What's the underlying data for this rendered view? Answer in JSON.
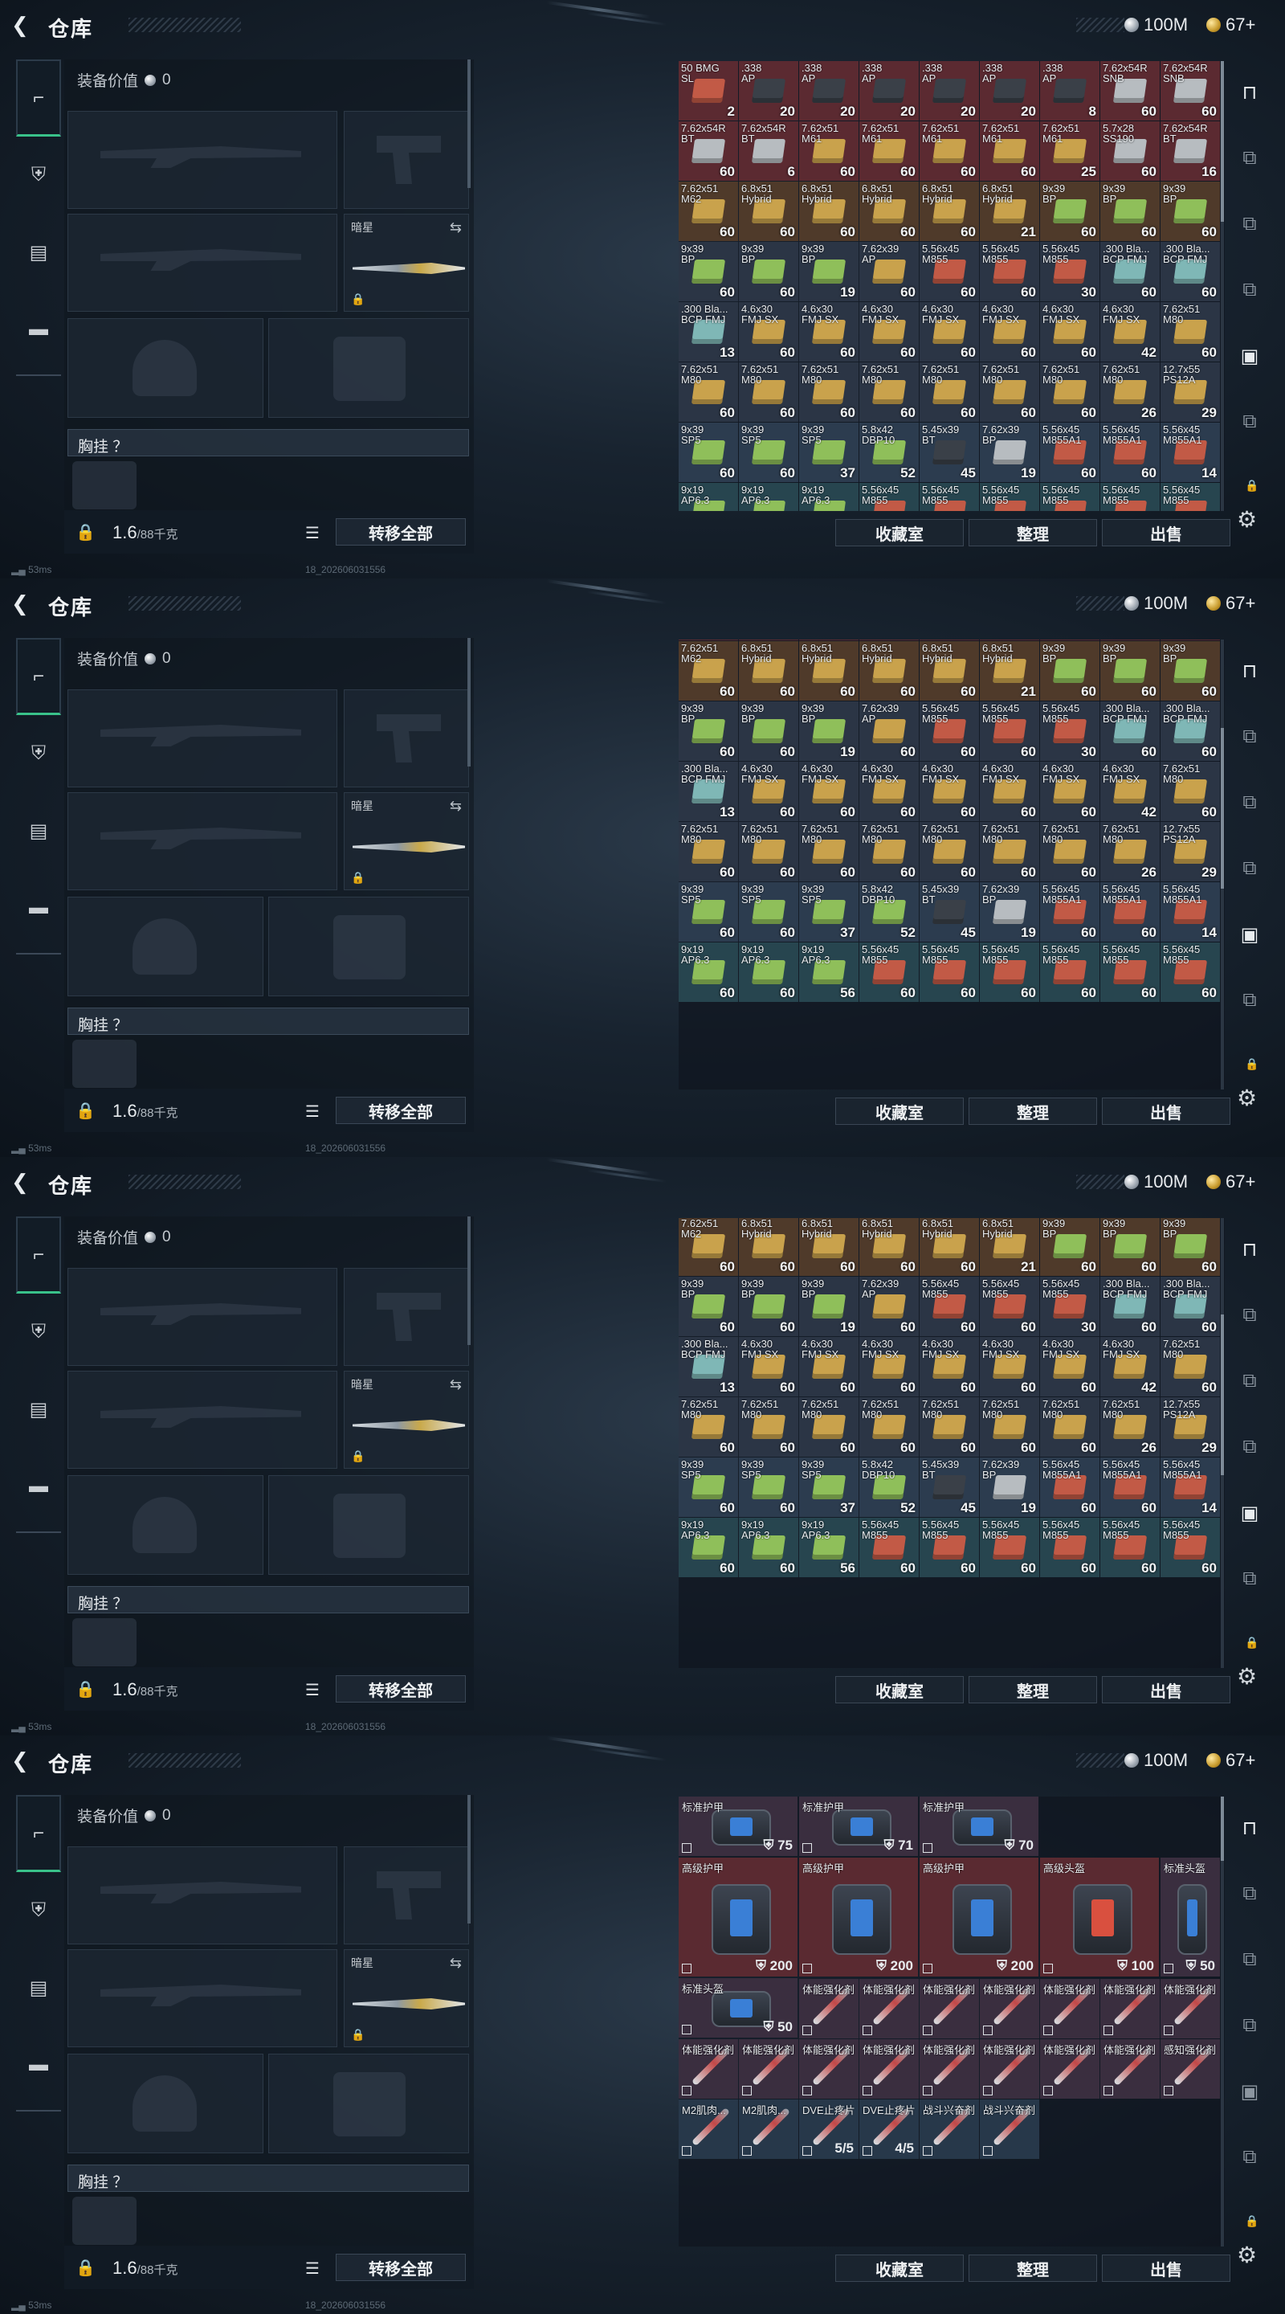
{
  "header": {
    "title": "仓库",
    "silver": "100M",
    "gold": "67+"
  },
  "left": {
    "equip_value_label": "装备价值",
    "equip_value": "0",
    "secondary_label": "暗星",
    "chest_label": "胸挂 ？",
    "weight": "1.6",
    "weight_max": "/88千克",
    "transfer_all": "转移全部"
  },
  "footer": {
    "collection": "收藏室",
    "sort": "整理",
    "sell": "出售"
  },
  "status": {
    "ping": "53ms",
    "uid": "18_202606031556"
  },
  "ammo_rows": [
    [
      {
        "n": "50 BMG\nSL",
        "q": "2",
        "c": "red",
        "b": "red"
      },
      {
        "n": ".338\nAP",
        "q": "20",
        "c": "red",
        "b": "dark"
      },
      {
        "n": ".338\nAP",
        "q": "20",
        "c": "red",
        "b": "dark"
      },
      {
        "n": ".338\nAP",
        "q": "20",
        "c": "red",
        "b": "dark"
      },
      {
        "n": ".338\nAP",
        "q": "20",
        "c": "red",
        "b": "dark"
      },
      {
        "n": ".338\nAP",
        "q": "20",
        "c": "red",
        "b": "dark"
      },
      {
        "n": ".338\nAP",
        "q": "8",
        "c": "red",
        "b": "dark"
      },
      {
        "n": "7.62x54R\nSNB",
        "q": "60",
        "c": "red",
        "b": "gray"
      },
      {
        "n": "7.62x54R\nSNB",
        "q": "60",
        "c": "red",
        "b": "gray"
      }
    ],
    [
      {
        "n": "7.62x54R\nBT",
        "q": "60",
        "c": "red",
        "b": "gray"
      },
      {
        "n": "7.62x54R\nBT",
        "q": "6",
        "c": "red",
        "b": "gray"
      },
      {
        "n": "7.62x51\nM61",
        "q": "60",
        "c": "red",
        "b": "gold"
      },
      {
        "n": "7.62x51\nM61",
        "q": "60",
        "c": "red",
        "b": "gold"
      },
      {
        "n": "7.62x51\nM61",
        "q": "60",
        "c": "red",
        "b": "gold"
      },
      {
        "n": "7.62x51\nM61",
        "q": "60",
        "c": "red",
        "b": "gold"
      },
      {
        "n": "7.62x51\nM61",
        "q": "25",
        "c": "red",
        "b": "gold"
      },
      {
        "n": "5.7x28\nSS190",
        "q": "60",
        "c": "red",
        "b": "gray"
      },
      {
        "n": "7.62x54R\nBT",
        "q": "16",
        "c": "red",
        "b": "gray"
      }
    ],
    [
      {
        "n": "7.62x51\nM62",
        "q": "60",
        "c": "brown",
        "b": "gold"
      },
      {
        "n": "6.8x51\nHybrid",
        "q": "60",
        "c": "brown",
        "b": "gold"
      },
      {
        "n": "6.8x51\nHybrid",
        "q": "60",
        "c": "brown",
        "b": "gold"
      },
      {
        "n": "6.8x51\nHybrid",
        "q": "60",
        "c": "brown",
        "b": "gold"
      },
      {
        "n": "6.8x51\nHybrid",
        "q": "60",
        "c": "brown",
        "b": "gold"
      },
      {
        "n": "6.8x51\nHybrid",
        "q": "21",
        "c": "brown",
        "b": "gold"
      },
      {
        "n": "9x39\nBP",
        "q": "60",
        "c": "brown",
        "b": "green"
      },
      {
        "n": "9x39\nBP",
        "q": "60",
        "c": "brown",
        "b": "green"
      },
      {
        "n": "9x39\nBP",
        "q": "60",
        "c": "brown",
        "b": "green"
      }
    ],
    [
      {
        "n": "9x39\nBP",
        "q": "60",
        "c": "dark",
        "b": "green"
      },
      {
        "n": "9x39\nBP",
        "q": "60",
        "c": "dark",
        "b": "green"
      },
      {
        "n": "9x39\nBP",
        "q": "19",
        "c": "dark",
        "b": "green"
      },
      {
        "n": "7.62x39\nAP",
        "q": "60",
        "c": "dark",
        "b": "gold"
      },
      {
        "n": "5.56x45\nM855",
        "q": "60",
        "c": "dark",
        "b": "red"
      },
      {
        "n": "5.56x45\nM855",
        "q": "60",
        "c": "dark",
        "b": "red"
      },
      {
        "n": "5.56x45\nM855",
        "q": "30",
        "c": "dark",
        "b": "red"
      },
      {
        "n": ".300 Bla...\nBCP FMJ",
        "q": "60",
        "c": "dark",
        "b": "teal"
      },
      {
        "n": ".300 Bla...\nBCP FMJ",
        "q": "60",
        "c": "dark",
        "b": "teal"
      }
    ],
    [
      {
        "n": ".300 Bla...\nBCP FMJ",
        "q": "13",
        "c": "dark",
        "b": "teal"
      },
      {
        "n": "4.6x30\nFMJ SX",
        "q": "60",
        "c": "dark",
        "b": "gold"
      },
      {
        "n": "4.6x30\nFMJ SX",
        "q": "60",
        "c": "dark",
        "b": "gold"
      },
      {
        "n": "4.6x30\nFMJ SX",
        "q": "60",
        "c": "dark",
        "b": "gold"
      },
      {
        "n": "4.6x30\nFMJ SX",
        "q": "60",
        "c": "dark",
        "b": "gold"
      },
      {
        "n": "4.6x30\nFMJ SX",
        "q": "60",
        "c": "dark",
        "b": "gold"
      },
      {
        "n": "4.6x30\nFMJ SX",
        "q": "60",
        "c": "dark",
        "b": "gold"
      },
      {
        "n": "4.6x30\nFMJ SX",
        "q": "42",
        "c": "dark",
        "b": "gold"
      },
      {
        "n": "7.62x51\nM80",
        "q": "60",
        "c": "dark",
        "b": "gold"
      }
    ],
    [
      {
        "n": "7.62x51\nM80",
        "q": "60",
        "c": "dark",
        "b": "gold"
      },
      {
        "n": "7.62x51\nM80",
        "q": "60",
        "c": "dark",
        "b": "gold"
      },
      {
        "n": "7.62x51\nM80",
        "q": "60",
        "c": "dark",
        "b": "gold"
      },
      {
        "n": "7.62x51\nM80",
        "q": "60",
        "c": "dark",
        "b": "gold"
      },
      {
        "n": "7.62x51\nM80",
        "q": "60",
        "c": "dark",
        "b": "gold"
      },
      {
        "n": "7.62x51\nM80",
        "q": "60",
        "c": "dark",
        "b": "gold"
      },
      {
        "n": "7.62x51\nM80",
        "q": "60",
        "c": "dark",
        "b": "gold"
      },
      {
        "n": "7.62x51\nM80",
        "q": "26",
        "c": "dark",
        "b": "gold"
      },
      {
        "n": "12.7x55\nPS12A",
        "q": "29",
        "c": "dark",
        "b": "gold"
      }
    ],
    [
      {
        "n": "9x39\nSP5",
        "q": "60",
        "c": "blue",
        "b": "green"
      },
      {
        "n": "9x39\nSP5",
        "q": "60",
        "c": "blue",
        "b": "green"
      },
      {
        "n": "9x39\nSP5",
        "q": "37",
        "c": "blue",
        "b": "green"
      },
      {
        "n": "5.8x42\nDBP10",
        "q": "52",
        "c": "blue",
        "b": "green"
      },
      {
        "n": "5.45x39\nBT",
        "q": "45",
        "c": "blue",
        "b": "dark"
      },
      {
        "n": "7.62x39\nBP",
        "q": "19",
        "c": "blue",
        "b": "gray"
      },
      {
        "n": "5.56x45\nM855A1",
        "q": "60",
        "c": "blue",
        "b": "red"
      },
      {
        "n": "5.56x45\nM855A1",
        "q": "60",
        "c": "blue",
        "b": "red"
      },
      {
        "n": "5.56x45\nM855A1",
        "q": "14",
        "c": "blue",
        "b": "red"
      }
    ],
    [
      {
        "n": "9x19\nAP6.3",
        "q": "60",
        "c": "teal",
        "b": "green"
      },
      {
        "n": "9x19\nAP6.3",
        "q": "60",
        "c": "teal",
        "b": "green"
      },
      {
        "n": "9x19\nAP6.3",
        "q": "56",
        "c": "teal",
        "b": "green"
      },
      {
        "n": "5.56x45\nM855",
        "q": "60",
        "c": "teal",
        "b": "red"
      },
      {
        "n": "5.56x45\nM855",
        "q": "60",
        "c": "teal",
        "b": "red"
      },
      {
        "n": "5.56x45\nM855",
        "q": "60",
        "c": "teal",
        "b": "red"
      },
      {
        "n": "5.56x45\nM855",
        "q": "60",
        "c": "teal",
        "b": "red"
      },
      {
        "n": "5.56x45\nM855",
        "q": "60",
        "c": "teal",
        "b": "red"
      },
      {
        "n": "5.56x45\nM855",
        "q": "60",
        "c": "teal",
        "b": "red"
      }
    ]
  ],
  "kit": {
    "std_armor": "标准护甲",
    "adv_armor": "高级护甲",
    "adv_helmet": "高级头盔",
    "std_helmet": "标准头盔",
    "a75": "75",
    "a71": "71",
    "a70": "70",
    "a200": "200",
    "a100": "100",
    "a50": "50",
    "stim": "体能强化剂",
    "sense": "感知强化剂",
    "m2": "M2肌肉...",
    "dve": "DVE止疼片",
    "combat": "战斗兴奋剂",
    "dve1": "5/5",
    "dve2": "4/5"
  }
}
